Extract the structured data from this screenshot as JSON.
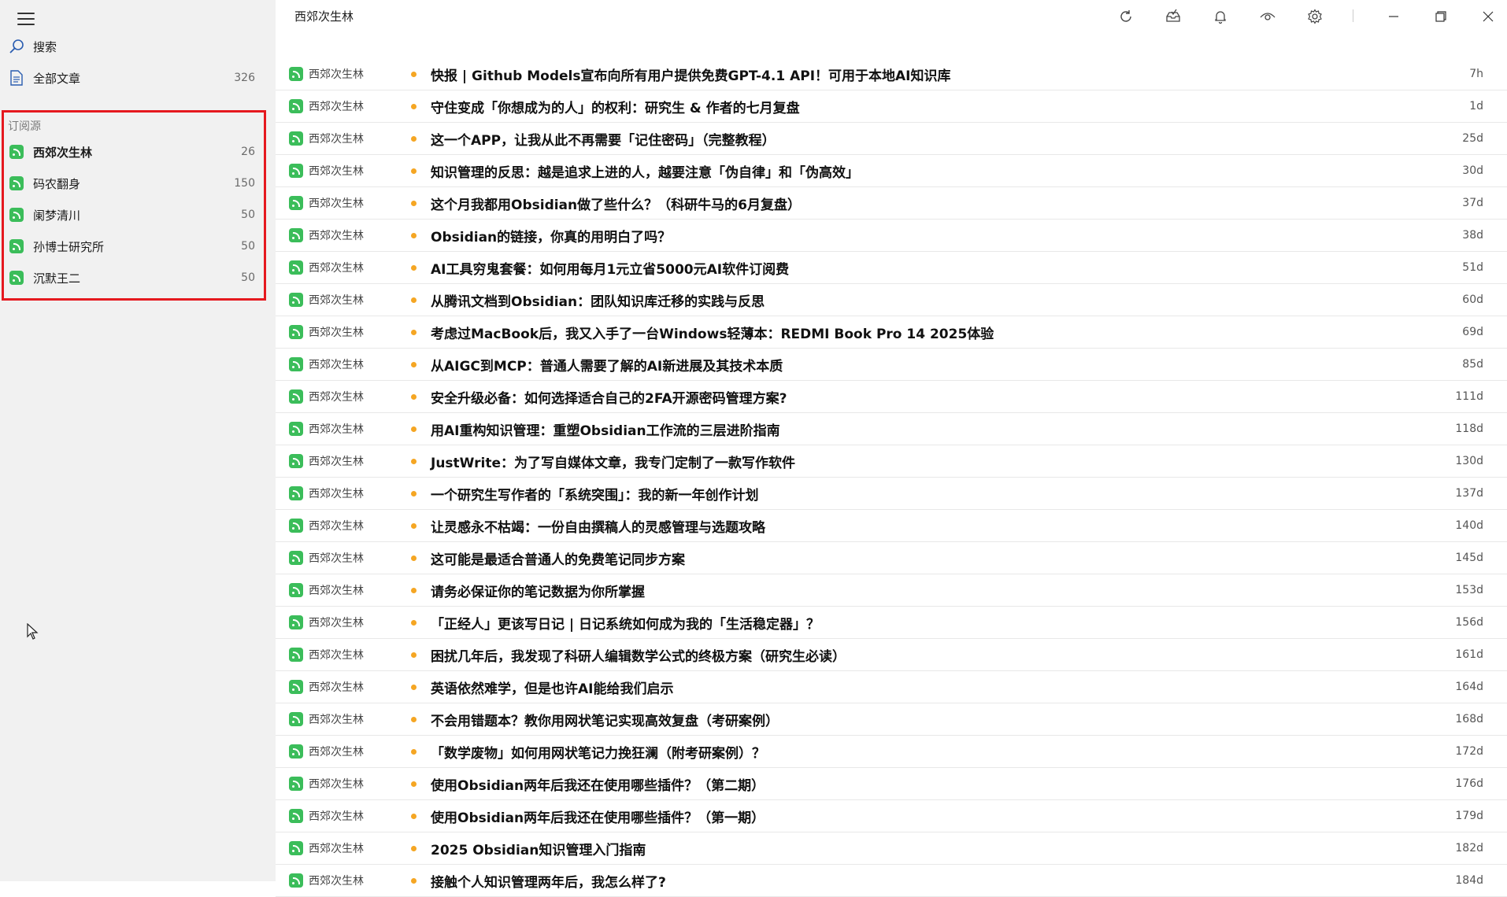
{
  "sidebar": {
    "search_label": "搜索",
    "all_articles": {
      "label": "全部文章",
      "count": "326"
    },
    "section_label": "订阅源",
    "feeds": [
      {
        "label": "西郊次生林",
        "count": "26"
      },
      {
        "label": "码农翻身",
        "count": "150"
      },
      {
        "label": "阑梦清川",
        "count": "50"
      },
      {
        "label": "孙博士研究所",
        "count": "50"
      },
      {
        "label": "沉默王二",
        "count": "50"
      }
    ]
  },
  "header": {
    "title": "西郊次生林"
  },
  "accent_color": "#f5a623",
  "feed_icon_color": "#3bbd5a",
  "highlight_color": "#e5191f",
  "articles": [
    {
      "source": "西郊次生林",
      "title": "快报 | Github Models宣布向所有用户提供免费GPT-4.1 API！可用于本地AI知识库",
      "age": "7h"
    },
    {
      "source": "西郊次生林",
      "title": "守住变成「你想成为的人」的权利：研究生 & 作者的七月复盘",
      "age": "1d"
    },
    {
      "source": "西郊次生林",
      "title": "这一个APP，让我从此不再需要「记住密码」（完整教程）",
      "age": "25d"
    },
    {
      "source": "西郊次生林",
      "title": "知识管理的反思：越是追求上进的人，越要注意「伪自律」和「伪高效」",
      "age": "30d"
    },
    {
      "source": "西郊次生林",
      "title": "这个月我都用Obsidian做了些什么？（科研牛马的6月复盘）",
      "age": "37d"
    },
    {
      "source": "西郊次生林",
      "title": "Obsidian的链接，你真的用明白了吗？",
      "age": "38d"
    },
    {
      "source": "西郊次生林",
      "title": "AI工具穷鬼套餐：如何用每月1元立省5000元AI软件订阅费",
      "age": "51d"
    },
    {
      "source": "西郊次生林",
      "title": "从腾讯文档到Obsidian：团队知识库迁移的实践与反思",
      "age": "60d"
    },
    {
      "source": "西郊次生林",
      "title": "考虑过MacBook后，我又入手了一台Windows轻薄本：REDMI Book Pro 14 2025体验",
      "age": "69d"
    },
    {
      "source": "西郊次生林",
      "title": "从AIGC到MCP：普通人需要了解的AI新进展及其技术本质",
      "age": "85d"
    },
    {
      "source": "西郊次生林",
      "title": "安全升级必备：如何选择适合自己的2FA开源密码管理方案?",
      "age": "111d"
    },
    {
      "source": "西郊次生林",
      "title": "用AI重构知识管理：重塑Obsidian工作流的三层进阶指南",
      "age": "118d"
    },
    {
      "source": "西郊次生林",
      "title": "JustWrite：为了写自媒体文章，我专门定制了一款写作软件",
      "age": "130d"
    },
    {
      "source": "西郊次生林",
      "title": "一个研究生写作者的「系统突围」：我的新一年创作计划",
      "age": "137d"
    },
    {
      "source": "西郊次生林",
      "title": "让灵感永不枯竭：一份自由撰稿人的灵感管理与选题攻略",
      "age": "140d"
    },
    {
      "source": "西郊次生林",
      "title": "这可能是最适合普通人的免费笔记同步方案",
      "age": "145d"
    },
    {
      "source": "西郊次生林",
      "title": "请务必保证你的笔记数据为你所掌握",
      "age": "153d"
    },
    {
      "source": "西郊次生林",
      "title": "「正经人」更该写日记 | 日记系统如何成为我的「生活稳定器」？",
      "age": "156d"
    },
    {
      "source": "西郊次生林",
      "title": "困扰几年后，我发现了科研人编辑数学公式的终极方案（研究生必读）",
      "age": "161d"
    },
    {
      "source": "西郊次生林",
      "title": "英语依然难学，但是也许AI能给我们启示",
      "age": "164d"
    },
    {
      "source": "西郊次生林",
      "title": "不会用错题本？教你用网状笔记实现高效复盘（考研案例）",
      "age": "168d"
    },
    {
      "source": "西郊次生林",
      "title": "「数学废物」如何用网状笔记力挽狂澜（附考研案例）？",
      "age": "172d"
    },
    {
      "source": "西郊次生林",
      "title": "使用Obsidian两年后我还在使用哪些插件？（第二期）",
      "age": "176d"
    },
    {
      "source": "西郊次生林",
      "title": "使用Obsidian两年后我还在使用哪些插件？（第一期）",
      "age": "179d"
    },
    {
      "source": "西郊次生林",
      "title": "2025 Obsidian知识管理入门指南",
      "age": "182d"
    },
    {
      "source": "西郊次生林",
      "title": "接触个人知识管理两年后，我怎么样了?",
      "age": "184d"
    }
  ]
}
